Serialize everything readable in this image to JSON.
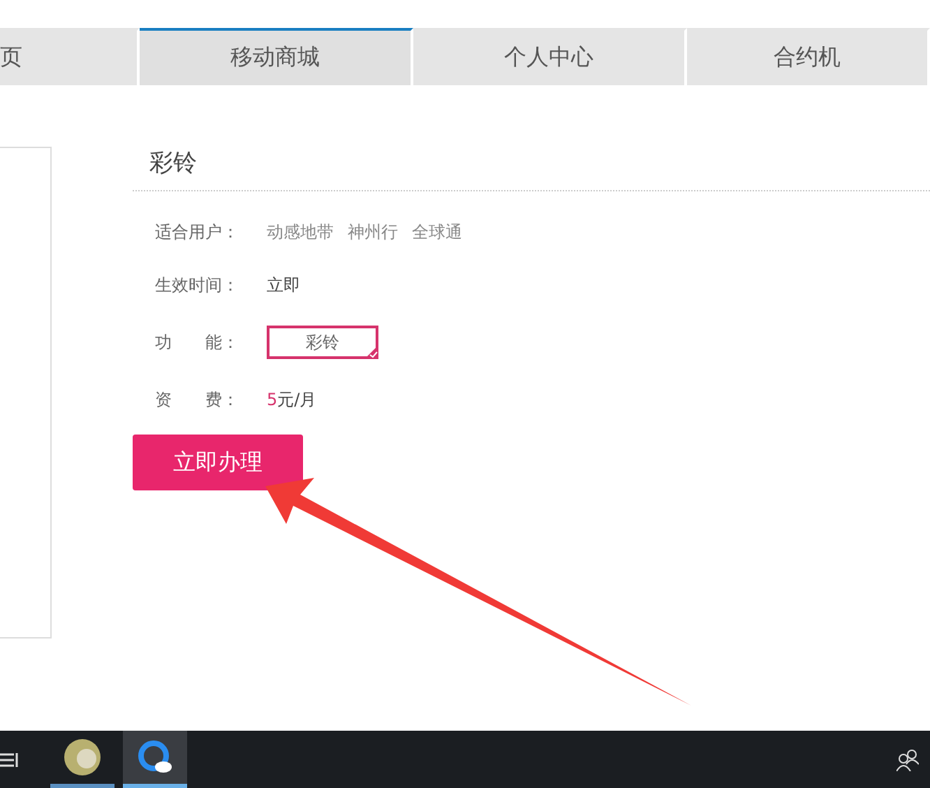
{
  "nav_tabs": [
    {
      "label": "页",
      "selected": false
    },
    {
      "label": "移动商城",
      "selected": true
    },
    {
      "label": "个人中心",
      "selected": false
    },
    {
      "label": "合约机",
      "selected": false
    }
  ],
  "product": {
    "title": "彩铃",
    "rows": [
      {
        "kind": "text",
        "label": "适合用户：",
        "values": [
          "动感地带",
          "神州行",
          "全球通"
        ]
      },
      {
        "kind": "text",
        "label": "生效时间：",
        "values": [
          "立即"
        ]
      },
      {
        "kind": "option",
        "label": "功　　能：",
        "option": {
          "label": "彩铃",
          "selected": true
        }
      },
      {
        "kind": "price",
        "label": "资　　费：",
        "amount": "5",
        "unit": "元/月"
      }
    ],
    "button": "立即办理"
  },
  "taskbar": {
    "apps": [
      {
        "kind": "avatar",
        "selected": false
      },
      {
        "kind": "browser",
        "selected": true
      }
    ]
  }
}
